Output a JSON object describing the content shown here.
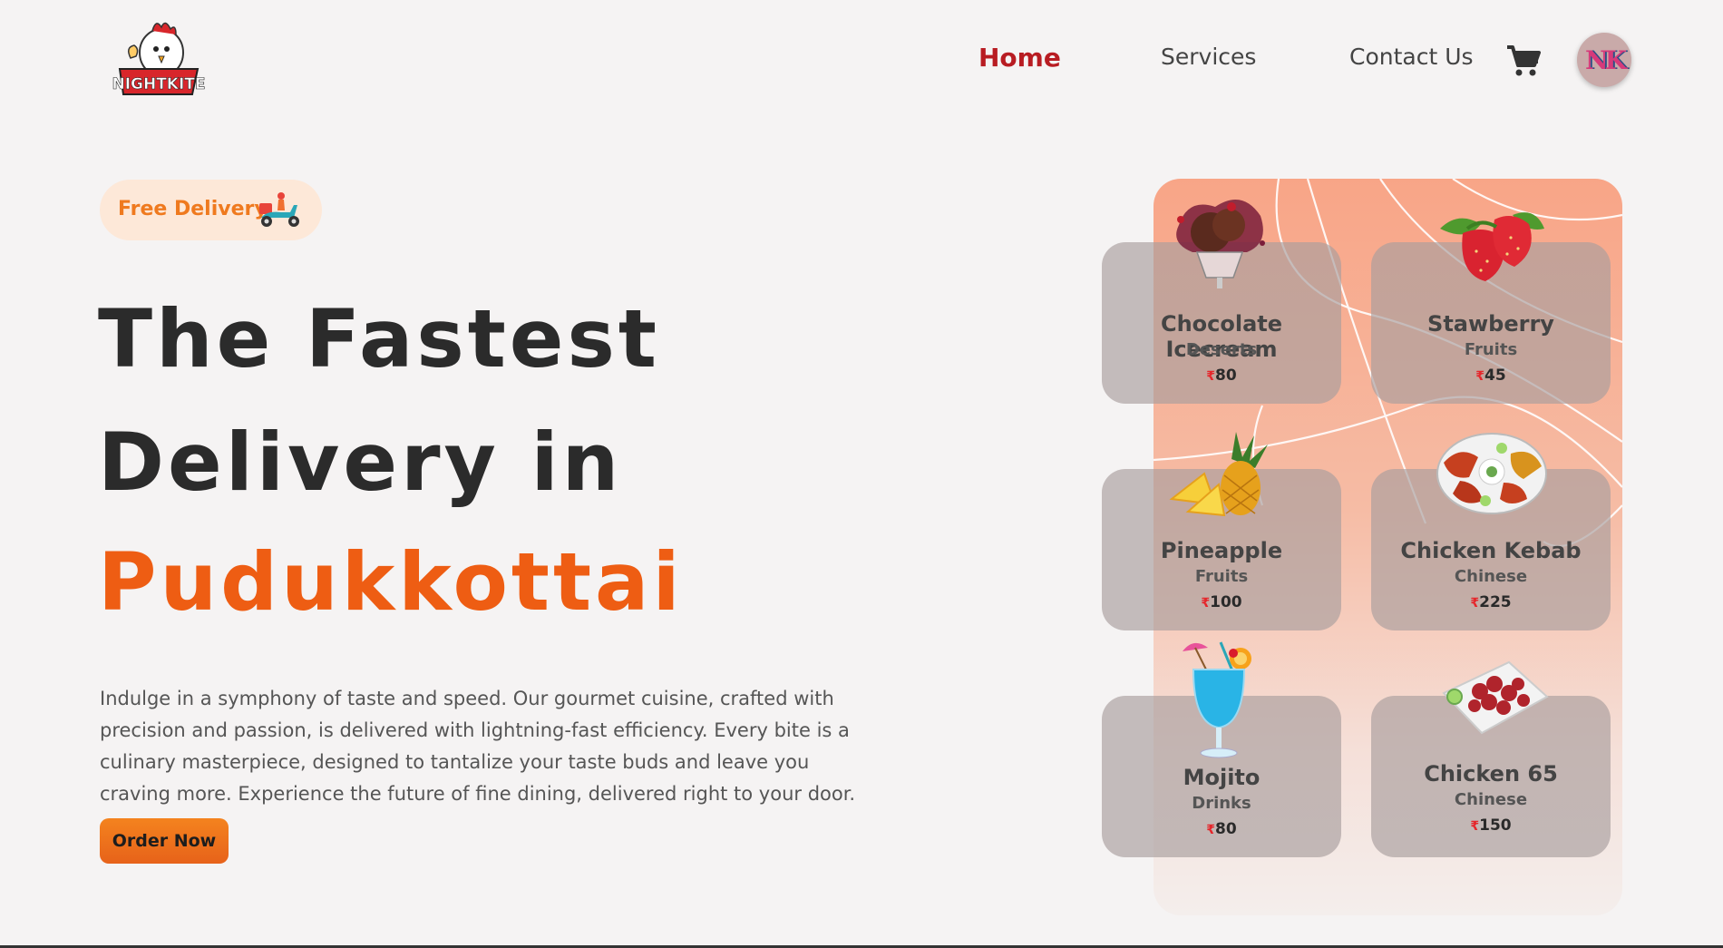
{
  "brand": {
    "logo_text": "NIGHTKITE"
  },
  "nav": {
    "home": "Home",
    "services": "Services",
    "contact": "Contact Us",
    "avatar_initials": "NK"
  },
  "hero": {
    "badge": "Free Delivery",
    "title_line1": "The Fastest",
    "title_line2": "Delivery in",
    "title_line3": "Pudukkottai",
    "description": "Indulge in a symphony of taste and speed. Our gourmet cuisine, crafted with precision and passion, is delivered with lightning-fast efficiency. Every bite is a culinary masterpiece, designed to tantalize your taste buds and leave you craving more. Experience the future of fine dining, delivered right to your door.",
    "cta": "Order Now"
  },
  "currency_symbol": "₹",
  "menu": [
    {
      "name": "Chocolate Icecream",
      "category": "Deserts",
      "price": "80",
      "icon": "ice-cream-icon"
    },
    {
      "name": "Stawberry",
      "category": "Fruits",
      "price": "45",
      "icon": "strawberry-icon"
    },
    {
      "name": "Pineapple",
      "category": "Fruits",
      "price": "100",
      "icon": "pineapple-icon"
    },
    {
      "name": "Chicken Kebab",
      "category": "Chinese",
      "price": "225",
      "icon": "kebab-platter-icon"
    },
    {
      "name": "Mojito",
      "category": "Drinks",
      "price": "80",
      "icon": "mojito-glass-icon"
    },
    {
      "name": "Chicken 65",
      "category": "Chinese",
      "price": "150",
      "icon": "chicken-65-plate-icon"
    }
  ],
  "colors": {
    "accent_red": "#b81c22",
    "accent_orange": "#ee5d13",
    "badge_bg": "#fde8d8",
    "background": "#f5f3f3"
  }
}
